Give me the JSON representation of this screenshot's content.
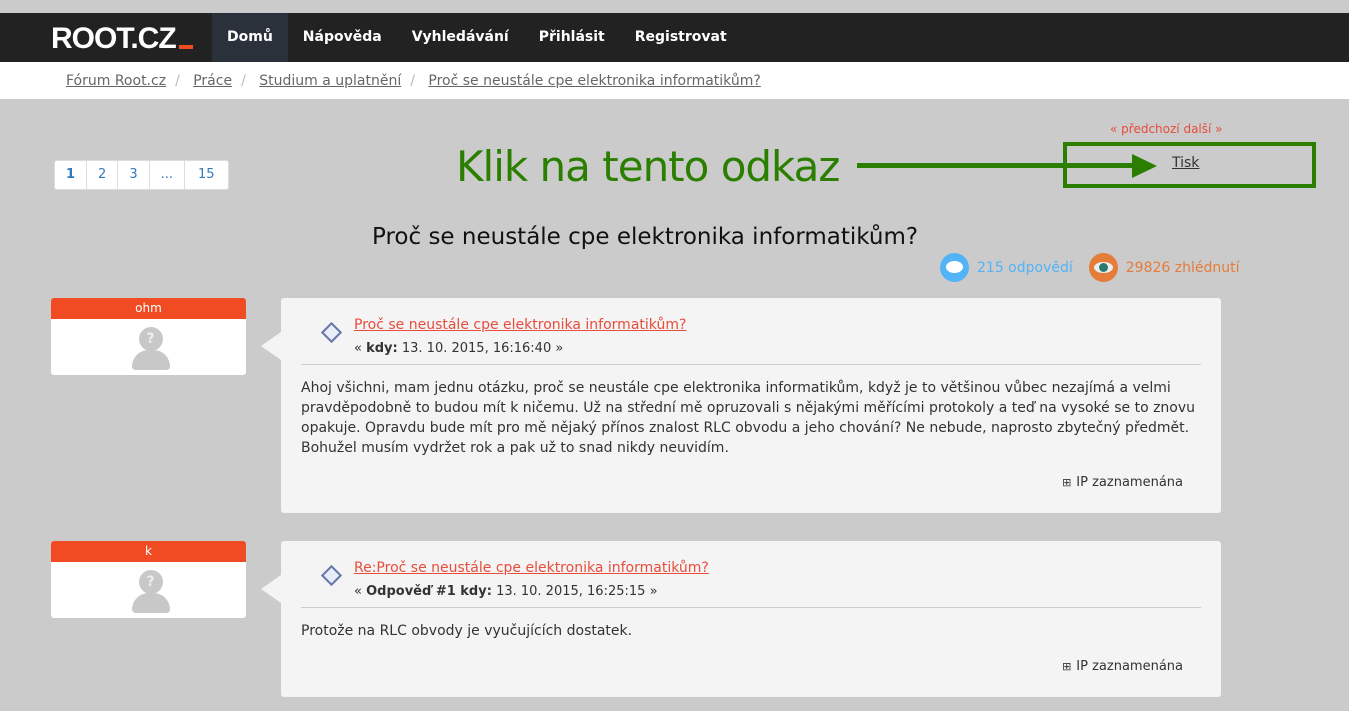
{
  "nav": {
    "logo": "ROOT.CZ",
    "items": [
      "Domů",
      "Nápověda",
      "Vyhledávání",
      "Přihlásit",
      "Registrovat"
    ]
  },
  "breadcrumb": [
    "Fórum Root.cz",
    "Práce",
    "Studium a uplatnění",
    "Proč se neustále cpe elektronika informatikům?"
  ],
  "pager": [
    "1",
    "2",
    "3",
    "...",
    "15"
  ],
  "annotation": {
    "text": "Klik na tento odkaz",
    "color": "#2a7f00"
  },
  "topic_nav": {
    "prev": "« předchozí",
    "next": "další »",
    "print": "Tisk"
  },
  "topic": {
    "title": "Proč se neustále cpe elektronika informatikům?",
    "replies": "215 odpovědí",
    "views": "29826 zhlédnutí"
  },
  "posts": [
    {
      "user": "ohm",
      "subject": "Proč se neustále cpe elektronika informatikům?",
      "meta_prefix": "«",
      "meta_label": "kdy:",
      "date": "13. 10. 2015, 16:16:40",
      "meta_suffix": "»",
      "body": "Ahoj všichni, mam jednu otázku, proč se neustále cpe elektronika informatikům, když je to většinou vůbec nezajímá a velmi pravděpodobně to budou mít k ničemu. Už na střední mě opruzovali s nějakými měřícími protokoly a teď na vysoké se to znovu opakuje. Opravdu bude mít pro mě nějaký přínos znalost RLC obvodu a jeho chování? Ne nebude, naprosto zbytečný předmět. Bohužel musím vydržet rok a pak už to snad nikdy neuvidím.",
      "ip": "IP zaznamenána"
    },
    {
      "user": "k",
      "subject": "Re:Proč se neustále cpe elektronika informatikům?",
      "meta_prefix": "«",
      "meta_label": "Odpověď #1 kdy:",
      "date": "13. 10. 2015, 16:25:15",
      "meta_suffix": "»",
      "body": "Protože na RLC obvody je vyučujících dostatek.",
      "ip": "IP zaznamenána"
    }
  ]
}
